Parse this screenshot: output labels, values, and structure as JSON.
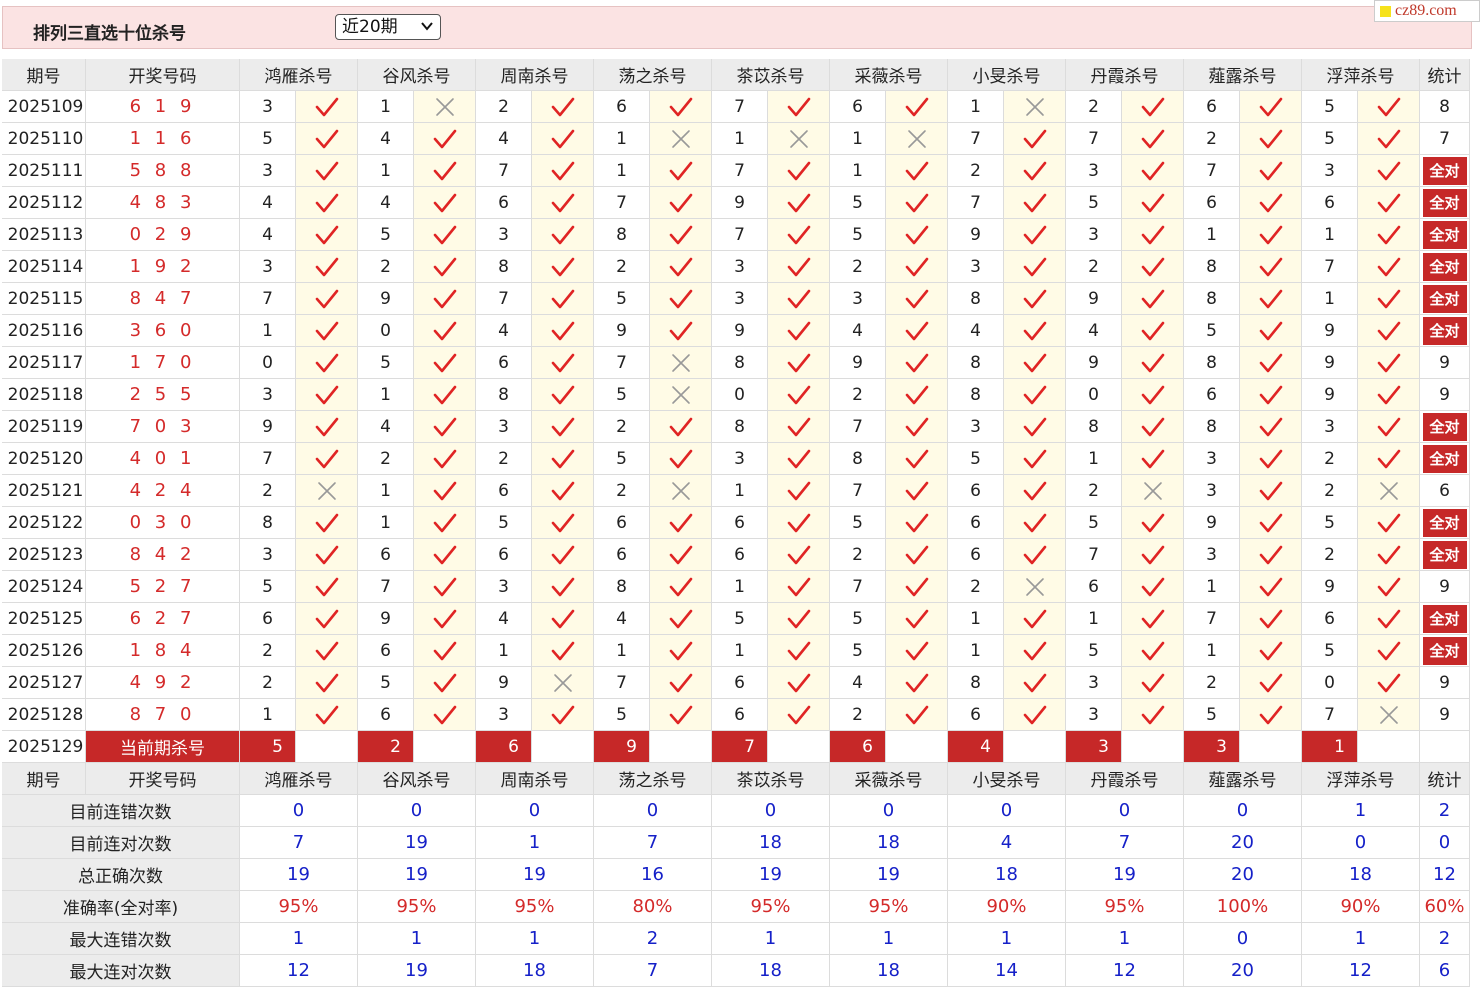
{
  "header": {
    "title": "排列三直选十位杀号",
    "period_select": "近20期",
    "watermark": "cz89.com"
  },
  "table": {
    "headers": [
      "期号",
      "开奖号码",
      "鸿雁杀号",
      "谷风杀号",
      "周南杀号",
      "荡之杀号",
      "茶苡杀号",
      "采薇杀号",
      "小旻杀号",
      "丹霞杀号",
      "薤露杀号",
      "浮萍杀号",
      "统计"
    ],
    "rows": [
      {
        "issue": "2025109",
        "draw": "6 1 9",
        "kills": [
          [
            3,
            1
          ],
          [
            1,
            0
          ],
          [
            2,
            1
          ],
          [
            6,
            1
          ],
          [
            7,
            1
          ],
          [
            6,
            1
          ],
          [
            1,
            0
          ],
          [
            2,
            1
          ],
          [
            6,
            1
          ],
          [
            5,
            1
          ]
        ],
        "stat": "8"
      },
      {
        "issue": "2025110",
        "draw": "1 1 6",
        "kills": [
          [
            5,
            1
          ],
          [
            4,
            1
          ],
          [
            4,
            1
          ],
          [
            1,
            0
          ],
          [
            1,
            0
          ],
          [
            1,
            0
          ],
          [
            7,
            1
          ],
          [
            7,
            1
          ],
          [
            2,
            1
          ],
          [
            5,
            1
          ]
        ],
        "stat": "7"
      },
      {
        "issue": "2025111",
        "draw": "5 8 8",
        "kills": [
          [
            3,
            1
          ],
          [
            1,
            1
          ],
          [
            7,
            1
          ],
          [
            1,
            1
          ],
          [
            7,
            1
          ],
          [
            1,
            1
          ],
          [
            2,
            1
          ],
          [
            3,
            1
          ],
          [
            7,
            1
          ],
          [
            3,
            1
          ]
        ],
        "stat": "全对"
      },
      {
        "issue": "2025112",
        "draw": "4 8 3",
        "kills": [
          [
            4,
            1
          ],
          [
            4,
            1
          ],
          [
            6,
            1
          ],
          [
            7,
            1
          ],
          [
            9,
            1
          ],
          [
            5,
            1
          ],
          [
            7,
            1
          ],
          [
            5,
            1
          ],
          [
            6,
            1
          ],
          [
            6,
            1
          ]
        ],
        "stat": "全对"
      },
      {
        "issue": "2025113",
        "draw": "0 2 9",
        "kills": [
          [
            4,
            1
          ],
          [
            5,
            1
          ],
          [
            3,
            1
          ],
          [
            8,
            1
          ],
          [
            7,
            1
          ],
          [
            5,
            1
          ],
          [
            9,
            1
          ],
          [
            3,
            1
          ],
          [
            1,
            1
          ],
          [
            1,
            1
          ]
        ],
        "stat": "全对"
      },
      {
        "issue": "2025114",
        "draw": "1 9 2",
        "kills": [
          [
            3,
            1
          ],
          [
            2,
            1
          ],
          [
            8,
            1
          ],
          [
            2,
            1
          ],
          [
            3,
            1
          ],
          [
            2,
            1
          ],
          [
            3,
            1
          ],
          [
            2,
            1
          ],
          [
            8,
            1
          ],
          [
            7,
            1
          ]
        ],
        "stat": "全对"
      },
      {
        "issue": "2025115",
        "draw": "8 4 7",
        "kills": [
          [
            7,
            1
          ],
          [
            9,
            1
          ],
          [
            7,
            1
          ],
          [
            5,
            1
          ],
          [
            3,
            1
          ],
          [
            3,
            1
          ],
          [
            8,
            1
          ],
          [
            9,
            1
          ],
          [
            8,
            1
          ],
          [
            1,
            1
          ]
        ],
        "stat": "全对"
      },
      {
        "issue": "2025116",
        "draw": "3 6 0",
        "kills": [
          [
            1,
            1
          ],
          [
            0,
            1
          ],
          [
            4,
            1
          ],
          [
            9,
            1
          ],
          [
            9,
            1
          ],
          [
            4,
            1
          ],
          [
            4,
            1
          ],
          [
            4,
            1
          ],
          [
            5,
            1
          ],
          [
            9,
            1
          ]
        ],
        "stat": "全对"
      },
      {
        "issue": "2025117",
        "draw": "1 7 0",
        "kills": [
          [
            0,
            1
          ],
          [
            5,
            1
          ],
          [
            6,
            1
          ],
          [
            7,
            0
          ],
          [
            8,
            1
          ],
          [
            9,
            1
          ],
          [
            8,
            1
          ],
          [
            9,
            1
          ],
          [
            8,
            1
          ],
          [
            9,
            1
          ]
        ],
        "stat": "9"
      },
      {
        "issue": "2025118",
        "draw": "2 5 5",
        "kills": [
          [
            3,
            1
          ],
          [
            1,
            1
          ],
          [
            8,
            1
          ],
          [
            5,
            0
          ],
          [
            0,
            1
          ],
          [
            2,
            1
          ],
          [
            8,
            1
          ],
          [
            0,
            1
          ],
          [
            6,
            1
          ],
          [
            9,
            1
          ]
        ],
        "stat": "9"
      },
      {
        "issue": "2025119",
        "draw": "7 0 3",
        "kills": [
          [
            9,
            1
          ],
          [
            4,
            1
          ],
          [
            3,
            1
          ],
          [
            2,
            1
          ],
          [
            8,
            1
          ],
          [
            7,
            1
          ],
          [
            3,
            1
          ],
          [
            8,
            1
          ],
          [
            8,
            1
          ],
          [
            3,
            1
          ]
        ],
        "stat": "全对"
      },
      {
        "issue": "2025120",
        "draw": "4 0 1",
        "kills": [
          [
            7,
            1
          ],
          [
            2,
            1
          ],
          [
            2,
            1
          ],
          [
            5,
            1
          ],
          [
            3,
            1
          ],
          [
            8,
            1
          ],
          [
            5,
            1
          ],
          [
            1,
            1
          ],
          [
            3,
            1
          ],
          [
            2,
            1
          ]
        ],
        "stat": "全对"
      },
      {
        "issue": "2025121",
        "draw": "4 2 4",
        "kills": [
          [
            2,
            0
          ],
          [
            1,
            1
          ],
          [
            6,
            1
          ],
          [
            2,
            0
          ],
          [
            1,
            1
          ],
          [
            7,
            1
          ],
          [
            6,
            1
          ],
          [
            2,
            0
          ],
          [
            3,
            1
          ],
          [
            2,
            0
          ]
        ],
        "stat": "6"
      },
      {
        "issue": "2025122",
        "draw": "0 3 0",
        "kills": [
          [
            8,
            1
          ],
          [
            1,
            1
          ],
          [
            5,
            1
          ],
          [
            6,
            1
          ],
          [
            6,
            1
          ],
          [
            5,
            1
          ],
          [
            6,
            1
          ],
          [
            5,
            1
          ],
          [
            9,
            1
          ],
          [
            5,
            1
          ]
        ],
        "stat": "全对"
      },
      {
        "issue": "2025123",
        "draw": "8 4 2",
        "kills": [
          [
            3,
            1
          ],
          [
            6,
            1
          ],
          [
            6,
            1
          ],
          [
            6,
            1
          ],
          [
            6,
            1
          ],
          [
            2,
            1
          ],
          [
            6,
            1
          ],
          [
            7,
            1
          ],
          [
            3,
            1
          ],
          [
            2,
            1
          ]
        ],
        "stat": "全对"
      },
      {
        "issue": "2025124",
        "draw": "5 2 7",
        "kills": [
          [
            5,
            1
          ],
          [
            7,
            1
          ],
          [
            3,
            1
          ],
          [
            8,
            1
          ],
          [
            1,
            1
          ],
          [
            7,
            1
          ],
          [
            2,
            0
          ],
          [
            6,
            1
          ],
          [
            1,
            1
          ],
          [
            9,
            1
          ]
        ],
        "stat": "9"
      },
      {
        "issue": "2025125",
        "draw": "6 2 7",
        "kills": [
          [
            6,
            1
          ],
          [
            9,
            1
          ],
          [
            4,
            1
          ],
          [
            4,
            1
          ],
          [
            5,
            1
          ],
          [
            5,
            1
          ],
          [
            1,
            1
          ],
          [
            1,
            1
          ],
          [
            7,
            1
          ],
          [
            6,
            1
          ]
        ],
        "stat": "全对"
      },
      {
        "issue": "2025126",
        "draw": "1 8 4",
        "kills": [
          [
            2,
            1
          ],
          [
            6,
            1
          ],
          [
            1,
            1
          ],
          [
            1,
            1
          ],
          [
            1,
            1
          ],
          [
            5,
            1
          ],
          [
            1,
            1
          ],
          [
            5,
            1
          ],
          [
            1,
            1
          ],
          [
            5,
            1
          ]
        ],
        "stat": "全对"
      },
      {
        "issue": "2025127",
        "draw": "4 9 2",
        "kills": [
          [
            2,
            1
          ],
          [
            5,
            1
          ],
          [
            9,
            0
          ],
          [
            7,
            1
          ],
          [
            6,
            1
          ],
          [
            4,
            1
          ],
          [
            8,
            1
          ],
          [
            3,
            1
          ],
          [
            2,
            1
          ],
          [
            0,
            1
          ]
        ],
        "stat": "9"
      },
      {
        "issue": "2025128",
        "draw": "8 7 0",
        "kills": [
          [
            1,
            1
          ],
          [
            6,
            1
          ],
          [
            3,
            1
          ],
          [
            5,
            1
          ],
          [
            6,
            1
          ],
          [
            2,
            1
          ],
          [
            6,
            1
          ],
          [
            3,
            1
          ],
          [
            5,
            1
          ],
          [
            7,
            0
          ]
        ],
        "stat": "9"
      }
    ],
    "current": {
      "issue": "2025129",
      "label": "当前期杀号",
      "kills": [
        "5",
        "2",
        "6",
        "9",
        "7",
        "6",
        "4",
        "3",
        "3",
        "1"
      ]
    },
    "summary": [
      {
        "label": "目前连错次数",
        "values": [
          "0",
          "0",
          "0",
          "0",
          "0",
          "0",
          "0",
          "0",
          "0",
          "1"
        ],
        "stat": "2",
        "style": "num"
      },
      {
        "label": "目前连对次数",
        "values": [
          "7",
          "19",
          "1",
          "7",
          "18",
          "18",
          "4",
          "7",
          "20",
          "0"
        ],
        "stat": "0",
        "style": "num"
      },
      {
        "label": "总正确次数",
        "values": [
          "19",
          "19",
          "19",
          "16",
          "19",
          "19",
          "18",
          "19",
          "20",
          "18"
        ],
        "stat": "12",
        "style": "num"
      },
      {
        "label": "准确率(全对率)",
        "values": [
          "95%",
          "95%",
          "95%",
          "80%",
          "95%",
          "95%",
          "90%",
          "95%",
          "100%",
          "90%"
        ],
        "stat": "60%",
        "style": "pct"
      },
      {
        "label": "最大连错次数",
        "values": [
          "1",
          "1",
          "1",
          "2",
          "1",
          "1",
          "1",
          "1",
          "0",
          "1"
        ],
        "stat": "2",
        "style": "num"
      },
      {
        "label": "最大连对次数",
        "values": [
          "12",
          "19",
          "18",
          "7",
          "18",
          "18",
          "14",
          "12",
          "20",
          "12"
        ],
        "stat": "6",
        "style": "num"
      }
    ]
  },
  "colors": {
    "accent_red": "#c62828",
    "check_red": "#e02424",
    "cross_gray": "#999999",
    "summary_blue": "#1520c8",
    "mark_bg": "#fffbe6",
    "header_bg": "#ececec",
    "topbar_bg": "#fbe3e3"
  },
  "icons": {
    "correct": "check-icon",
    "wrong": "cross-icon",
    "dropdown": "chevron-down-icon"
  }
}
